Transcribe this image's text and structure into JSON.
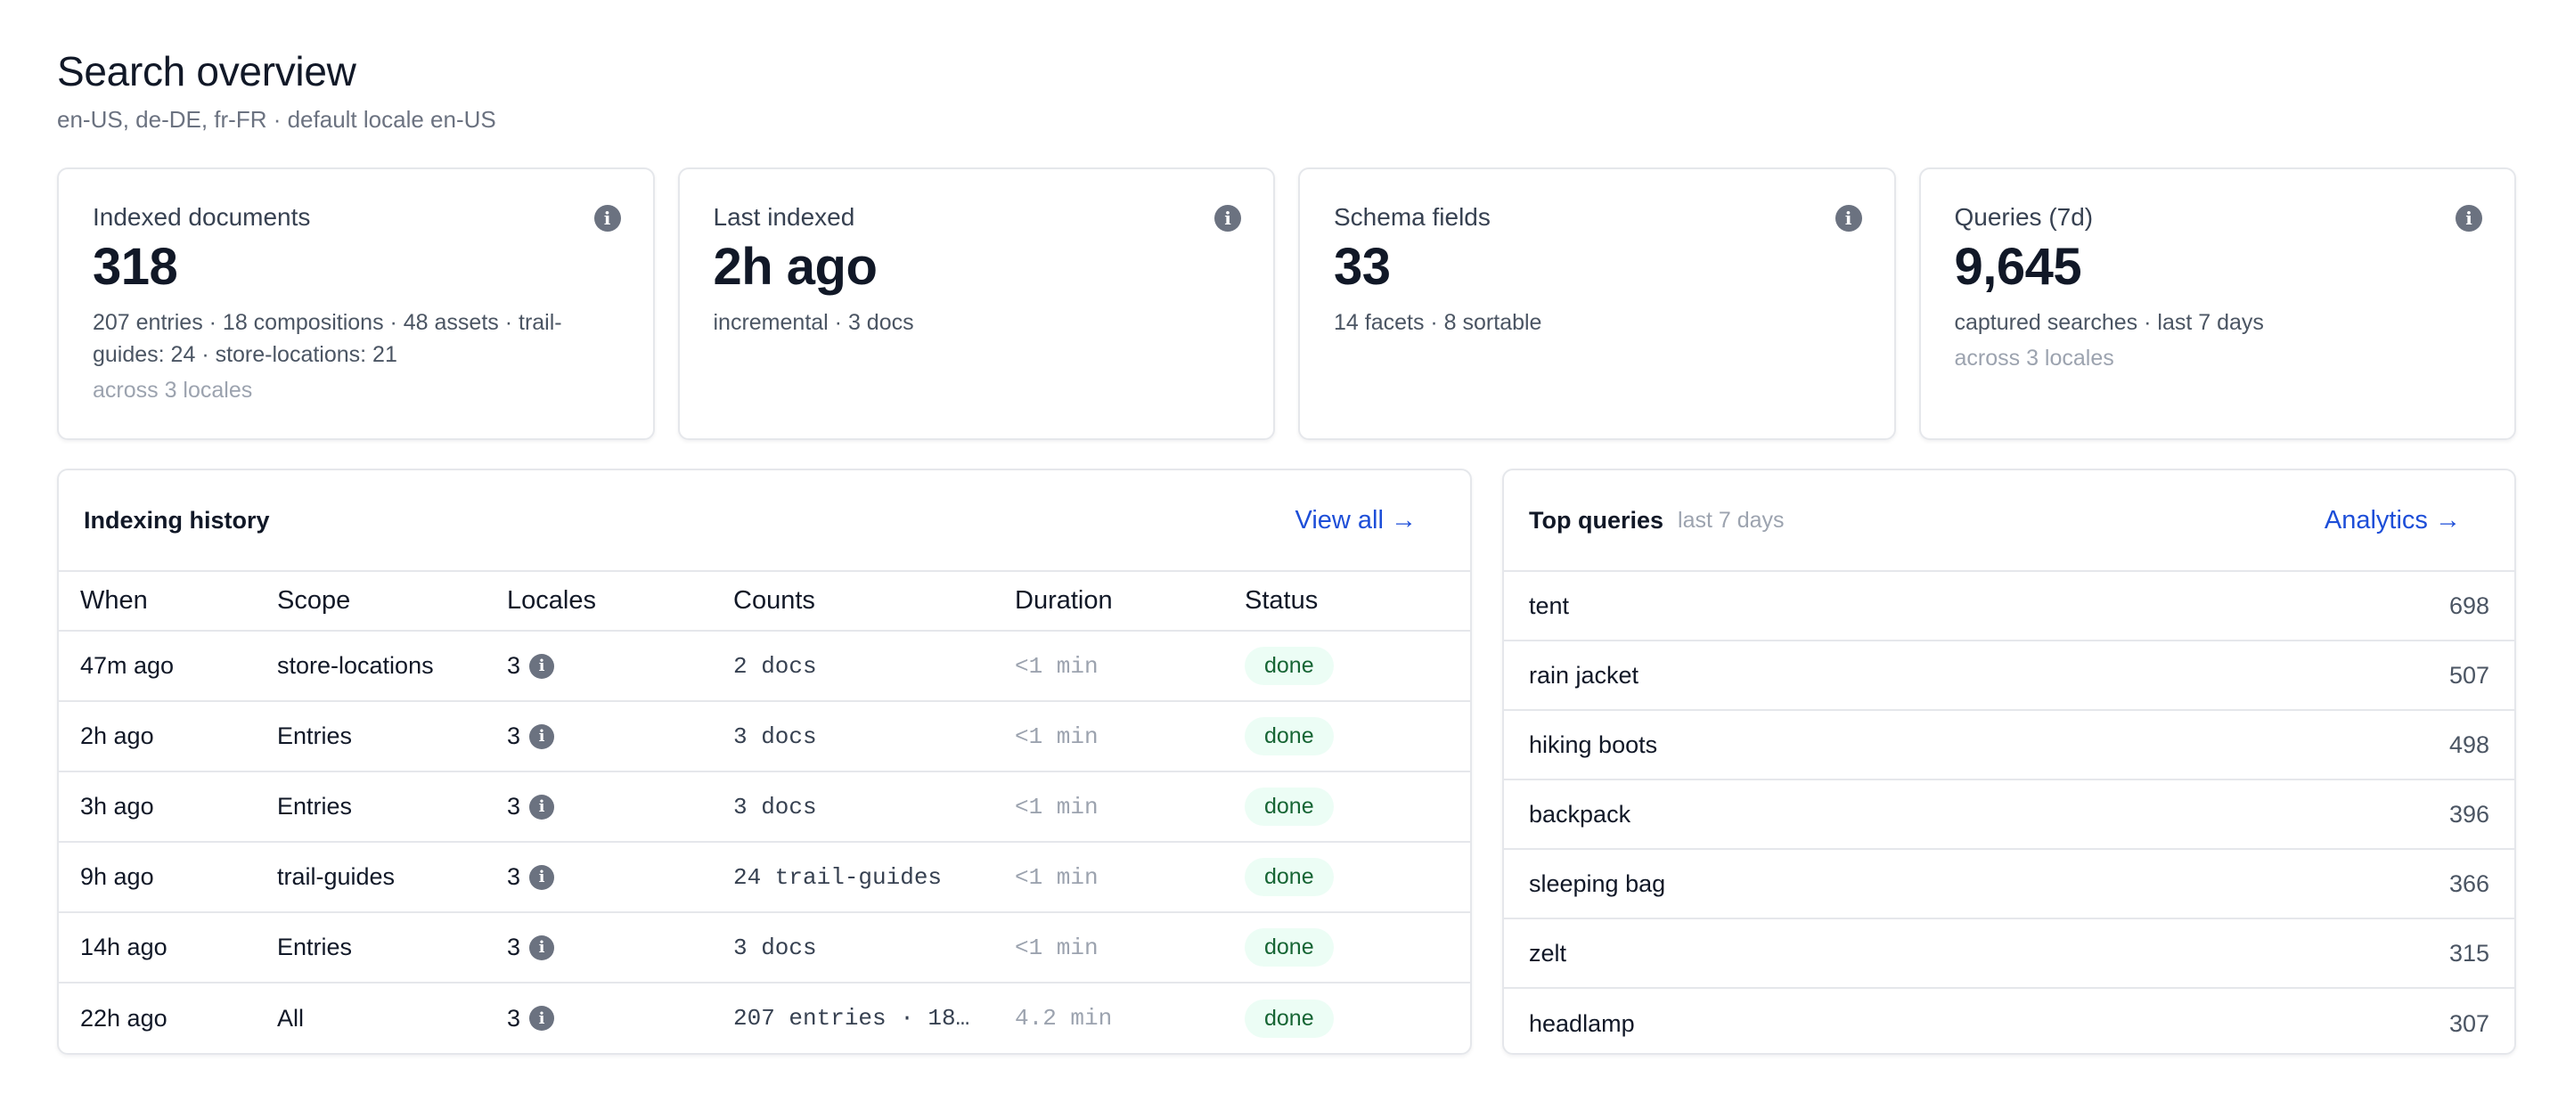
{
  "header": {
    "title": "Search overview",
    "subtitle": "en-US, de-DE, fr-FR · default locale en-US"
  },
  "stats": [
    {
      "label": "Indexed documents",
      "value": "318",
      "detail": "207 entries · 18 compositions · 48 assets · trail-guides: 24 · store-locations: 21",
      "sub": "across 3 locales"
    },
    {
      "label": "Last indexed",
      "value": "2h ago",
      "detail": "incremental · 3 docs",
      "sub": ""
    },
    {
      "label": "Schema fields",
      "value": "33",
      "detail": "14 facets · 8 sortable",
      "sub": ""
    },
    {
      "label": "Queries (7d)",
      "value": "9,645",
      "detail": "captured searches · last 7 days",
      "sub": "across 3 locales"
    }
  ],
  "info_icon_glyph": "i",
  "history": {
    "title": "Indexing history",
    "link": "View all →",
    "columns": [
      "When",
      "Scope",
      "Locales",
      "Counts",
      "Duration",
      "Status"
    ],
    "rows": [
      {
        "when": "47m ago",
        "scope": "store-locations",
        "locales": "3",
        "counts": "2 docs",
        "duration": "<1 min",
        "status": "done"
      },
      {
        "when": "2h ago",
        "scope": "Entries",
        "locales": "3",
        "counts": "3 docs",
        "duration": "<1 min",
        "status": "done"
      },
      {
        "when": "3h ago",
        "scope": "Entries",
        "locales": "3",
        "counts": "3 docs",
        "duration": "<1 min",
        "status": "done"
      },
      {
        "when": "9h ago",
        "scope": "trail-guides",
        "locales": "3",
        "counts": "24 trail-guides",
        "duration": "<1 min",
        "status": "done"
      },
      {
        "when": "14h ago",
        "scope": "Entries",
        "locales": "3",
        "counts": "3 docs",
        "duration": "<1 min",
        "status": "done"
      },
      {
        "when": "22h ago",
        "scope": "All",
        "locales": "3",
        "counts": "207 entries · 18…",
        "duration": "4.2 min",
        "status": "done"
      }
    ]
  },
  "top_queries": {
    "title": "Top queries",
    "hint": "last 7 days",
    "link": "Analytics →",
    "items": [
      {
        "query": "tent",
        "count": "698"
      },
      {
        "query": "rain jacket",
        "count": "507"
      },
      {
        "query": "hiking boots",
        "count": "498"
      },
      {
        "query": "backpack",
        "count": "396"
      },
      {
        "query": "sleeping bag",
        "count": "366"
      },
      {
        "query": "zelt",
        "count": "315"
      },
      {
        "query": "headlamp",
        "count": "307"
      }
    ]
  },
  "colors": {
    "accent_link": "#1d4ed8",
    "status_done_bg": "#ecfdf5",
    "status_done_text": "#166534",
    "info_icon": "#6b7280"
  },
  "icons": {
    "stat_info": "info-circle-icon",
    "locale_info": "info-circle-icon"
  }
}
